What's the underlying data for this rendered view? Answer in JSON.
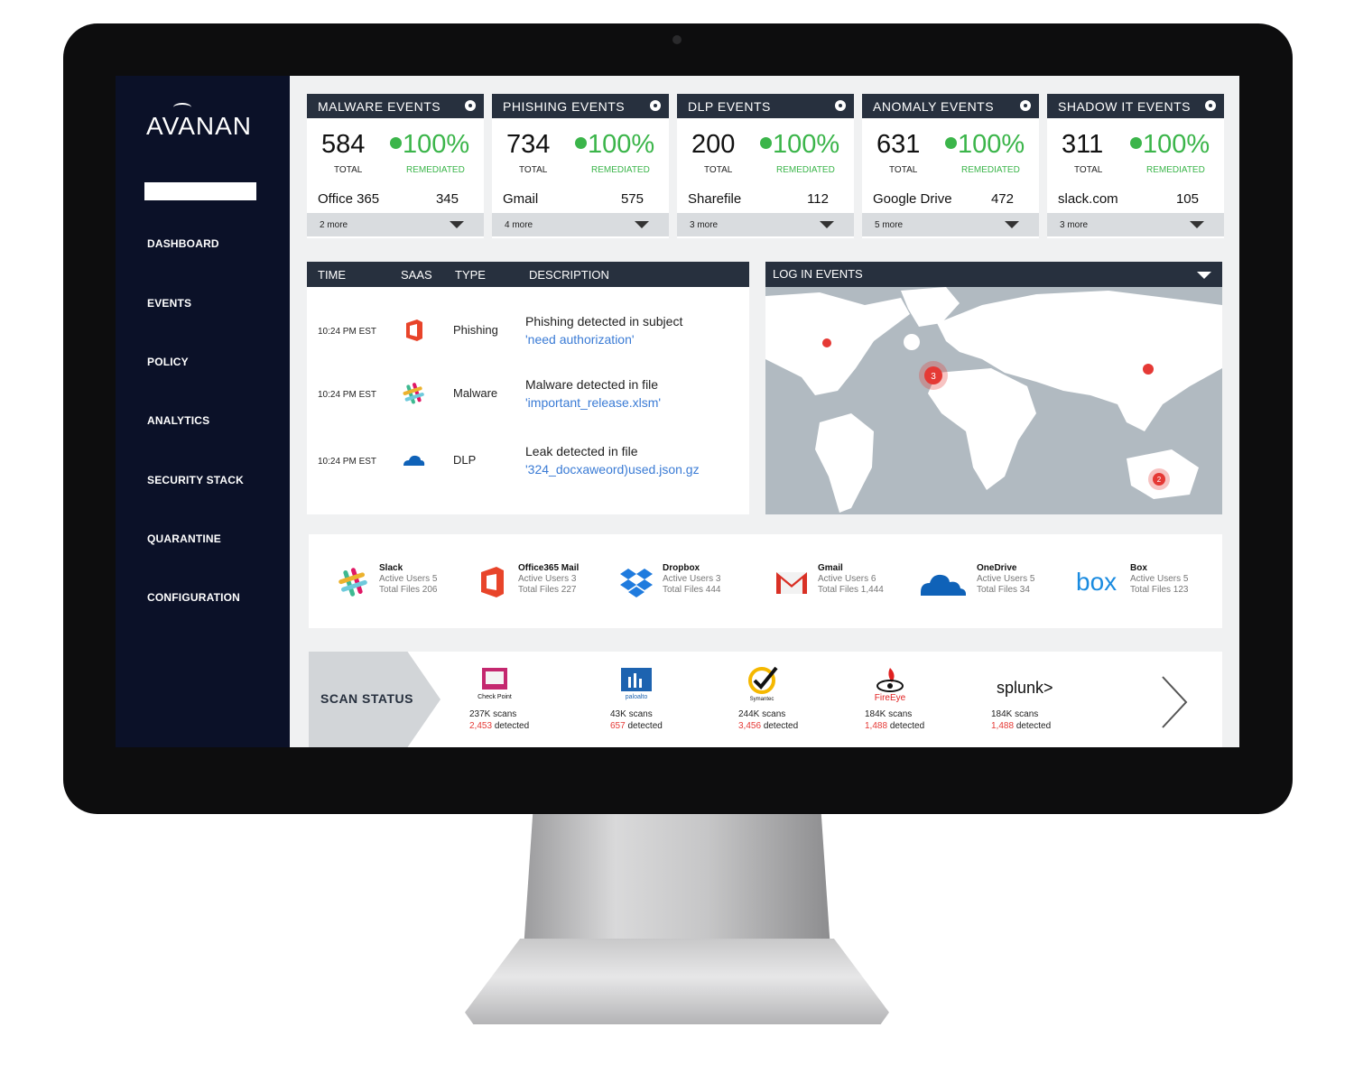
{
  "sidebar": {
    "logo": "AVANAN",
    "nav": [
      "DASHBOARD",
      "EVENTS",
      "POLICY",
      "ANALYTICS",
      "SECURITY STACK",
      "QUARANTINE",
      "CONFIGURATION"
    ]
  },
  "cards": [
    {
      "title": "MALWARE EVENTS",
      "total": "584",
      "total_label": "TOTAL",
      "pct": "100%",
      "pct_label": "REMEDIATED",
      "top_app": "Office 365",
      "top_val": "345",
      "more": "2 more"
    },
    {
      "title": "PHISHING EVENTS",
      "total": "734",
      "total_label": "TOTAL",
      "pct": "100%",
      "pct_label": "REMEDIATED",
      "top_app": "Gmail",
      "top_val": "575",
      "more": "4 more"
    },
    {
      "title": "DLP EVENTS",
      "total": "200",
      "total_label": "TOTAL",
      "pct": "100%",
      "pct_label": "REMEDIATED",
      "top_app": "Sharefile",
      "top_val": "112",
      "more": "3 more"
    },
    {
      "title": "ANOMALY EVENTS",
      "total": "631",
      "total_label": "TOTAL",
      "pct": "100%",
      "pct_label": "REMEDIATED",
      "top_app": "Google Drive",
      "top_val": "472",
      "more": "5 more"
    },
    {
      "title": "SHADOW IT EVENTS",
      "total": "311",
      "total_label": "TOTAL",
      "pct": "100%",
      "pct_label": "REMEDIATED",
      "top_app": "slack.com",
      "top_val": "105",
      "more": "3 more"
    }
  ],
  "log": {
    "headers": {
      "time": "TIME",
      "saas": "SAAS",
      "type": "TYPE",
      "description": "DESCRIPTION"
    },
    "rows": [
      {
        "time": "10:24 PM EST",
        "saas_icon": "office365-icon",
        "type": "Phishing",
        "desc": "Phishing detected in subject",
        "file": "'need authorization'"
      },
      {
        "time": "10:24 PM EST",
        "saas_icon": "slack-icon",
        "type": "Malware",
        "desc": "Malware detected in file",
        "file": "'important_release.xlsm'"
      },
      {
        "time": "10:24 PM EST",
        "saas_icon": "onedrive-icon",
        "type": "DLP",
        "desc": "Leak detected in file",
        "file": "'324_docxaweord)used.json.gz"
      }
    ]
  },
  "map": {
    "title": "LOG IN EVENTS",
    "clusters": [
      {
        "label": "3"
      },
      {
        "label": "2"
      }
    ]
  },
  "apps": [
    {
      "name": "Slack",
      "users": "Active Users 5",
      "files": "Total Files 206",
      "icon": "slack-icon"
    },
    {
      "name": "Office365 Mail",
      "users": "Active Users 3",
      "files": "Total Files 227",
      "icon": "office365-icon"
    },
    {
      "name": "Dropbox",
      "users": "Active Users 3",
      "files": "Total Files 444",
      "icon": "dropbox-icon"
    },
    {
      "name": "Gmail",
      "users": "Active Users 6",
      "files": "Total Files 1,444",
      "icon": "gmail-icon"
    },
    {
      "name": "OneDrive",
      "users": "Active Users 5",
      "files": "Total Files 34",
      "icon": "onedrive-icon"
    },
    {
      "name": "Box",
      "users": "Active Users 5",
      "files": "Total Files 123",
      "icon": "box-icon"
    }
  ],
  "scan": {
    "label": "SCAN STATUS",
    "vendors": [
      {
        "name": "Check Point",
        "scans": "237K scans",
        "detected_num": "2,453",
        "detected_label": "detected"
      },
      {
        "name": "paloalto",
        "scans": "43K scans",
        "detected_num": "657",
        "detected_label": "detected"
      },
      {
        "name": "Symantec",
        "scans": "244K scans",
        "detected_num": "3,456",
        "detected_label": "detected"
      },
      {
        "name": "FireEye",
        "scans": "184K scans",
        "detected_num": "1,488",
        "detected_label": "detected"
      },
      {
        "name": "splunk>",
        "scans": "184K scans",
        "detected_num": "1,488",
        "detected_label": "detected"
      }
    ]
  },
  "colors": {
    "sidebar": "#0b1128",
    "header": "#27303e",
    "green": "#3bb54a",
    "link": "#3a7bd5",
    "red": "#e53935"
  }
}
